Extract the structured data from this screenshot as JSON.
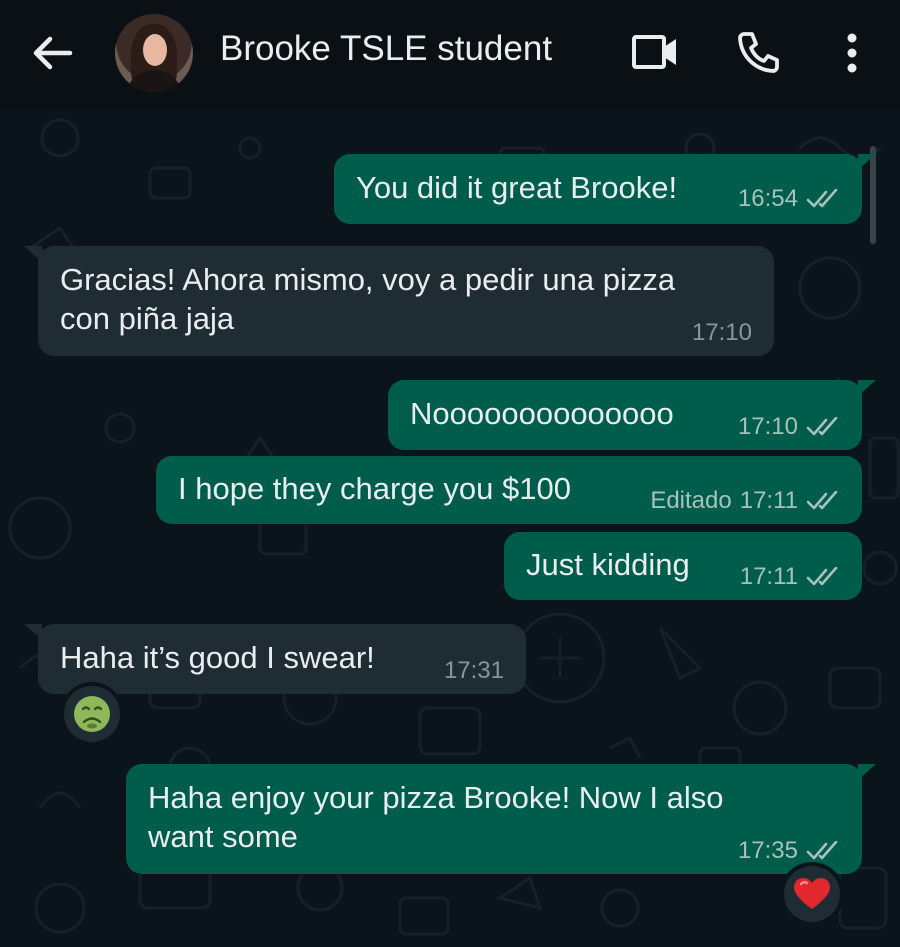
{
  "header": {
    "contact_name": "Brooke TSLE student",
    "icons": [
      "back-arrow-icon",
      "video-call-icon",
      "phone-icon",
      "more-options-icon"
    ]
  },
  "messages": [
    {
      "dir": "out",
      "text": "You did it great Brooke!",
      "time": "16:54",
      "status": "read"
    },
    {
      "dir": "in",
      "text": "Gracias! Ahora mismo, voy a pedir una pizza\ncon piña jaja",
      "time": "17:10"
    },
    {
      "dir": "out",
      "text": "Noooooooooooooo",
      "time": "17:10",
      "status": "read"
    },
    {
      "dir": "out",
      "text": "I hope they charge you $100",
      "edited": "Editado",
      "time": "17:11",
      "status": "read"
    },
    {
      "dir": "out",
      "text": "Just kidding",
      "time": "17:11",
      "status": "read"
    },
    {
      "dir": "in",
      "text": "Haha it’s good I swear!",
      "time": "17:31",
      "reaction": "nauseated-face"
    },
    {
      "dir": "out",
      "text": "Haha enjoy your pizza Brooke! Now I also\nwant some",
      "time": "17:35",
      "status": "read",
      "reaction": "red-heart"
    }
  ],
  "colors": {
    "background": "#0b141a",
    "outgoing_bubble": "#005c4b",
    "incoming_bubble": "#202c33",
    "header": "#0b1014"
  }
}
